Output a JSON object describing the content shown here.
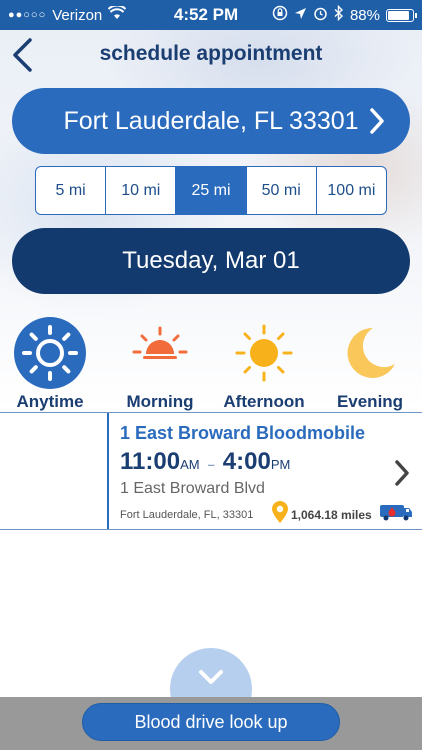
{
  "status_bar": {
    "signal": "●●○○○",
    "carrier": "Verizon",
    "time": "4:52 PM",
    "battery": "88%"
  },
  "header": {
    "title": "schedule appointment"
  },
  "location": {
    "label": "Fort Lauderdale, FL 33301"
  },
  "distance": {
    "options": [
      "5 mi",
      "10 mi",
      "25 mi",
      "50 mi",
      "100 mi"
    ],
    "selected": "25 mi"
  },
  "date": {
    "label": "Tuesday, Mar 01"
  },
  "time_of_day": {
    "options": [
      "Anytime",
      "Morning",
      "Afternoon",
      "Evening"
    ],
    "selected": "Anytime"
  },
  "result": {
    "name": "1 East Broward Bloodmobile",
    "start_time": "11:00",
    "start_ampm": "AM",
    "separator": "–",
    "end_time": "4:00",
    "end_ampm": "PM",
    "address": "1 East Broward Blvd",
    "city": "Fort Lauderdale, FL, 33301",
    "distance": "1,064.18 miles"
  },
  "footer": {
    "lookup_label": "Blood drive look up"
  },
  "colors": {
    "primary": "#2a6bbd",
    "dark": "#123a6e",
    "title": "#1b3e72",
    "sun_orange": "#f26b3a",
    "sun_yellow": "#f7b21b",
    "moon": "#fac75a"
  }
}
